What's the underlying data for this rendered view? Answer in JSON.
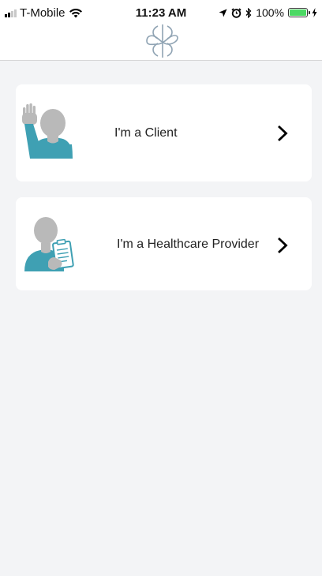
{
  "status_bar": {
    "carrier": "T-Mobile",
    "time": "11:23 AM",
    "battery": "100%",
    "battery_level": 1.0
  },
  "header": {
    "logo_icon": "infinity-knot-logo-icon"
  },
  "options": [
    {
      "label": "I'm a Client",
      "icon": "raised-hand-person-icon"
    },
    {
      "label": "I'm a Healthcare Provider",
      "icon": "person-clipboard-icon"
    }
  ],
  "colors": {
    "accent_teal": "#3fa0b3",
    "avatar_gray": "#b9b9b9",
    "background": "#f3f4f6",
    "card": "#ffffff",
    "battery_green": "#4cd964"
  }
}
